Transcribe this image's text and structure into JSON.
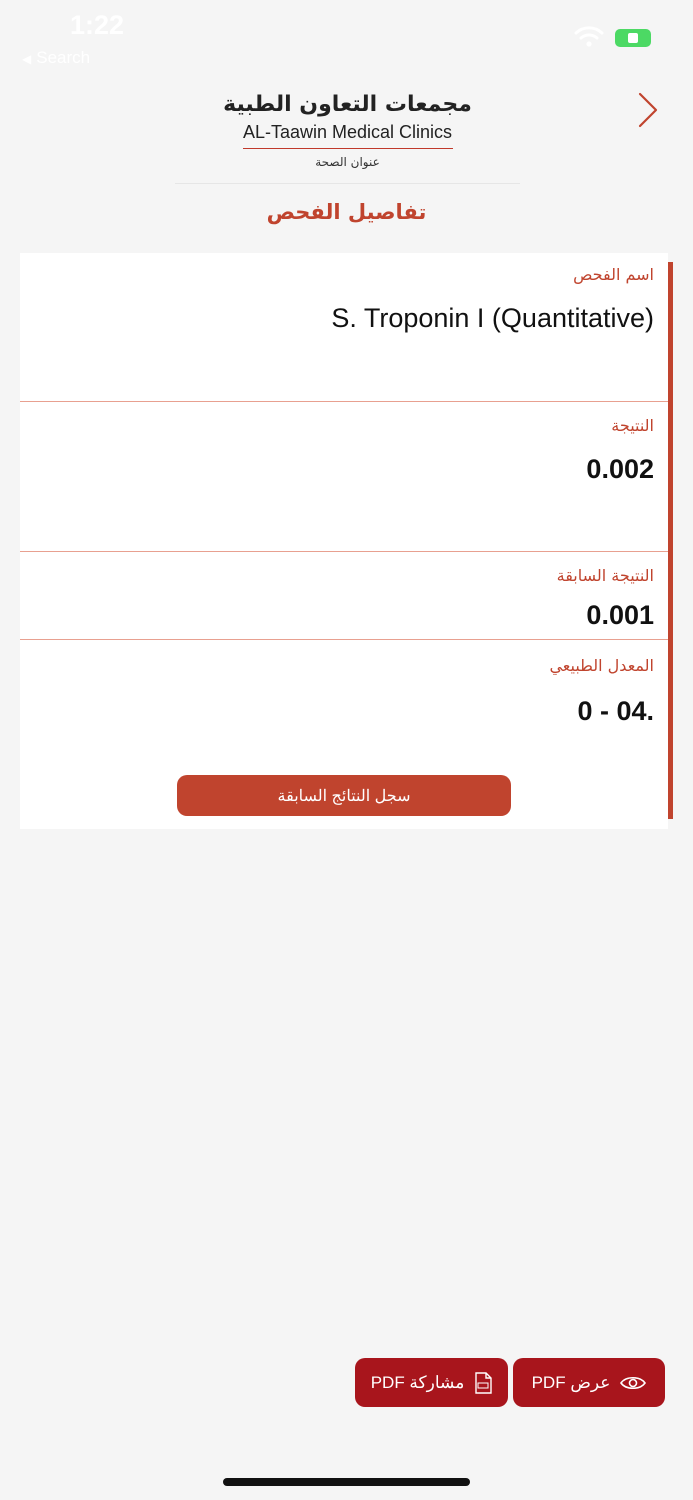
{
  "status_bar": {
    "time": "1:22",
    "back_label": "Search"
  },
  "header": {
    "logo_ar": "مجمعات التعاون الطبية",
    "logo_en": "AL-Taawin Medical Clinics",
    "logo_sub": "عنوان الصحة"
  },
  "page_title": "تفاصيل الفحص",
  "details": {
    "test_name_label": "اسم الفحص",
    "test_name": "S. Troponin I (Quantitative)",
    "result_label": "النتيجة",
    "result": "0.002",
    "previous_result_label": "النتيجة السابقة",
    "previous_result": "0.001",
    "normal_range_label": "المعدل الطبيعي",
    "normal_range": "0 - 04."
  },
  "history_button": "سجل النتائج السابقة",
  "actions": {
    "view_pdf": "عرض PDF",
    "share_pdf": "مشاركة PDF"
  },
  "colors": {
    "accent": "#c0442e",
    "pdf_button": "#a8151c",
    "background": "#f5f5f5"
  },
  "icons": {
    "view": "eye-icon",
    "share": "pdf-file-icon",
    "nav": "chevron-right-icon"
  }
}
